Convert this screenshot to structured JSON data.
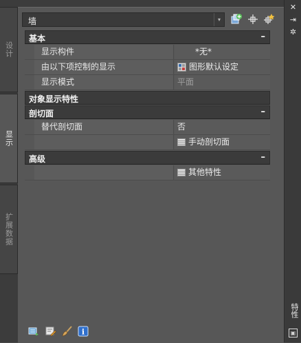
{
  "left_tabs": [
    {
      "label": "设计",
      "active": false
    },
    {
      "label": "显示",
      "active": true
    },
    {
      "label": "扩展数据",
      "active": false
    }
  ],
  "right_strip": {
    "title": "特性",
    "close_glyph": "✕",
    "autohide_glyph": "⇥",
    "settings_glyph": "✲"
  },
  "dropdown": {
    "value": "墙",
    "arrow_glyph": "▾"
  },
  "toolbar_icons": [
    "add-style-icon",
    "quick-select-icon",
    "select-objects-icon"
  ],
  "categories": {
    "basic": {
      "label": "基本",
      "toggle": "–",
      "rows": [
        {
          "key": "显示构件",
          "value": "*无*"
        },
        {
          "key": "由以下项控制的显示",
          "value": "图形默认设定"
        },
        {
          "key": "显示模式",
          "value": "平面"
        }
      ]
    },
    "object_display": {
      "label": "对象显示特性"
    },
    "section": {
      "label": "剖切面",
      "toggle": "–",
      "rows": [
        {
          "key": "替代剖切面",
          "value": "否"
        },
        {
          "key": "",
          "value": "手动剖切面"
        }
      ]
    },
    "advanced": {
      "label": "高级",
      "toggle": "–",
      "rows": [
        {
          "key": "",
          "value": "其他特性"
        }
      ]
    }
  },
  "bottom_icons": [
    "display-manager-icon",
    "edit-style-icon",
    "brush-icon",
    "info-icon"
  ],
  "info_glyph": "i",
  "colors": {
    "panel": "#575757",
    "category_bar": "#3b3b3b",
    "dim_text": "#9e9e9e"
  }
}
